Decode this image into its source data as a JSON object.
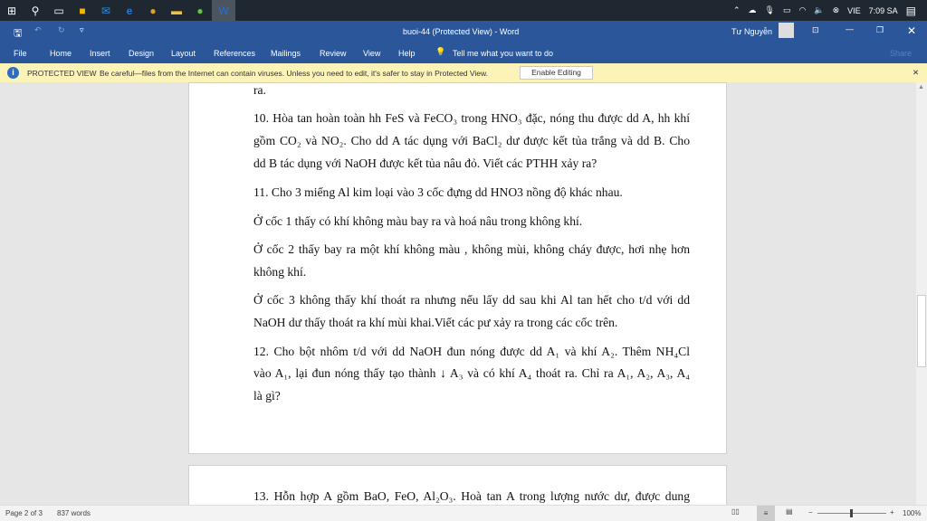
{
  "taskbar": {
    "icons": [
      "windows-start",
      "search",
      "task-view",
      "store",
      "mail",
      "edge",
      "chrome",
      "file-explorer",
      "greenshot",
      "word"
    ],
    "tray": {
      "language": "VIE",
      "time": "7:09 SA"
    }
  },
  "titlebar": {
    "title": "buoi-44 (Protected View)  -  Word",
    "user": "Tư Nguyễn"
  },
  "ribbon": {
    "tabs": [
      "File",
      "Home",
      "Insert",
      "Design",
      "Layout",
      "References",
      "Mailings",
      "Review",
      "View",
      "Help"
    ],
    "tell_me": "Tell me what you want to do",
    "share": "Share"
  },
  "protected_view": {
    "label": "PROTECTED VIEW",
    "message": "Be careful—files from the Internet can contain viruses. Unless you need to edit, it's safer to stay in Protected View.",
    "button": "Enable Editing"
  },
  "document": {
    "page1_lines": [
      "ra.",
      "10. Hòa tan hoàn toàn hh FeS và FeCO₃ trong HNO₃ đặc, nóng thu được dd A, hh khí",
      "gồm CO₂ và NO₂. Cho dd A tác dụng với BaCl₂ dư được kết tủa trắng và dd B. Cho",
      "dd B tác dụng với NaOH được kết tủa nâu đỏ. Viết các PTHH xảy ra?",
      "11. Cho 3 miếng Al kim loại vào 3 cốc đựng dd HNO3 nồng độ khác nhau.",
      " Ở cốc 1 thấy có khí không màu bay ra và hoá nâu trong không khí.",
      " Ở cốc 2 thấy bay ra một  khí không màu , không mùi, không cháy được, hơi nhẹ hơn",
      "không khí.",
      " Ở cốc 3 không thấy khí thoát ra nhưng nếu lấy dd sau khi Al tan hết cho t/d với dd",
      "NaOH dư thấy thoát ra khí mùi khai.Viết các pư xảy ra trong các cốc trên.",
      "12. Cho bột nhôm t/d với dd NaOH đun nóng được dd A₁ và khí A₂. Thêm NH₄Cl",
      "vào A₁, lại đun nóng thấy tạo thành ↓ A₃ và có khí A₄ thoát ra. Chỉ ra A₁, A₂, A₃, A₄",
      "là gì?"
    ],
    "page2_lines": [
      "13. Hỗn hợp A gồm BaO, FeO, Al₂O₃. Hoà tan A trong lượng nước dư, được dung"
    ]
  },
  "status": {
    "page": "Page 2 of 3",
    "words": "837 words",
    "zoom": "100%",
    "zoom_value": 100
  }
}
